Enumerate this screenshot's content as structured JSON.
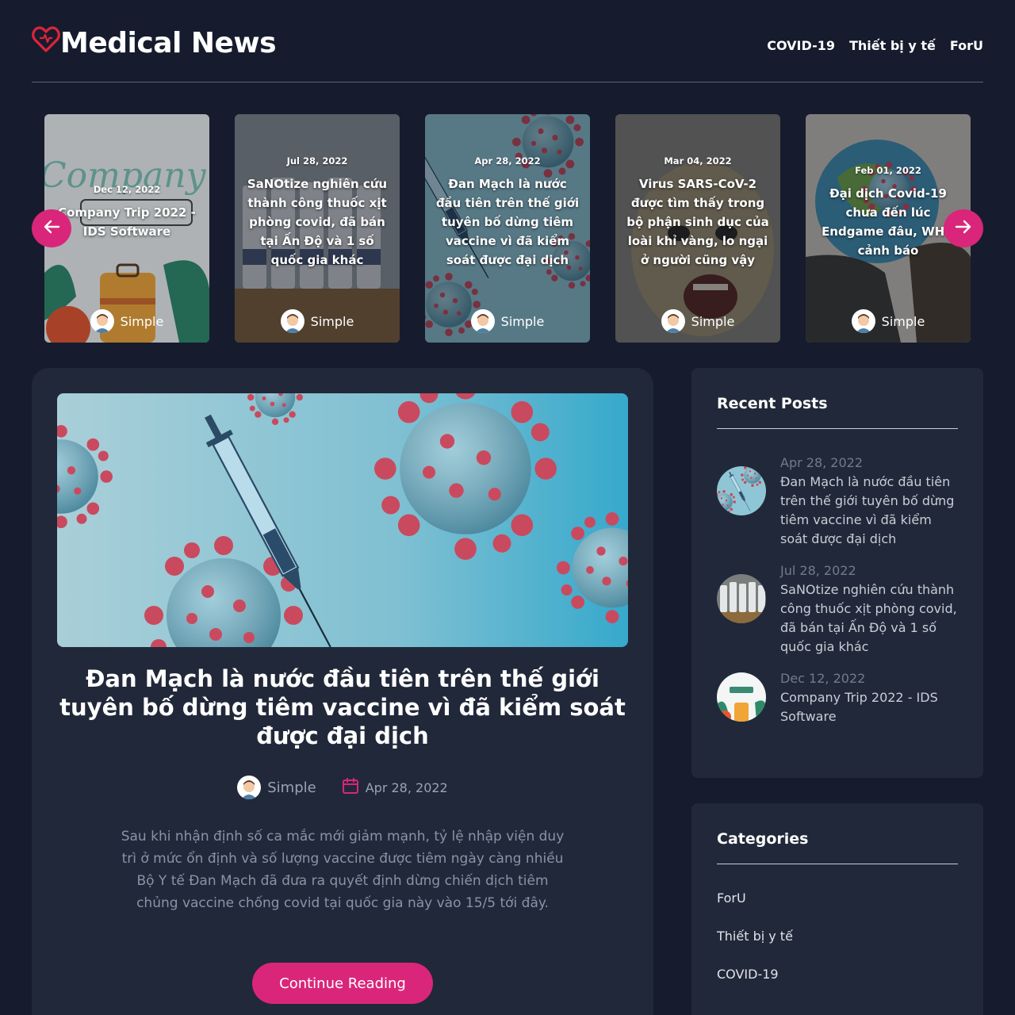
{
  "brand": {
    "name": "Medical News",
    "logo_icon": "heart-icon",
    "accent": "#d9267a"
  },
  "nav": [
    {
      "label": "COVID-19"
    },
    {
      "label": "Thiết bị y tế"
    },
    {
      "label": "ForU"
    }
  ],
  "carousel": {
    "prev_icon": "arrow-left-icon",
    "next_icon": "arrow-right-icon",
    "cards": [
      {
        "date": "Dec 12, 2022",
        "title": "Company Trip 2022 - IDS Software",
        "author": "Simple",
        "image": "company-trip-illustration"
      },
      {
        "date": "Jul 28, 2022",
        "title": "SaNOtize nghiên cứu thành công thuốc xịt phòng covid, đã bán tại Ấn Độ và 1 số quốc gia khác",
        "author": "Simple",
        "image": "spray-bottles-photo"
      },
      {
        "date": "Apr 28, 2022",
        "title": "Đan Mạch là nước đầu tiên trên thế giới tuyên bố dừng tiêm vaccine vì đã kiểm soát được đại dịch",
        "author": "Simple",
        "image": "virus-syringe-photo"
      },
      {
        "date": "Mar 04, 2022",
        "title": "Virus SARS-CoV-2 được tìm thấy trong bộ phận sinh dục của loài khỉ vàng, lo ngại ở người cũng vậy",
        "author": "Simple",
        "image": "monkey-photo"
      },
      {
        "date": "Feb 01, 2022",
        "title": "Đại dịch Covid-19 chưa đến lúc Endgame đâu, WHO cảnh báo",
        "author": "Simple",
        "image": "covid-globe-art"
      }
    ]
  },
  "main_post": {
    "title": "Đan Mạch là nước đầu tiên trên thế giới tuyên bố dừng tiêm vaccine vì đã kiểm soát được đại dịch",
    "author": "Simple",
    "date": "Apr 28, 2022",
    "date_icon": "calendar-icon",
    "excerpt": "Sau khi nhận định số ca mắc mới giảm mạnh, tỷ lệ nhập viện duy trì ở mức ổn định và số lượng vaccine được tiêm ngày càng nhiều Bộ Y tế Đan Mạch đã đưa ra quyết định dừng chiến dịch tiêm chủng vaccine chống covid tại quốc gia này vào 15/5 tới đây.",
    "button": "Continue Reading",
    "image": "virus-syringe-photo"
  },
  "recent_posts": {
    "heading": "Recent Posts",
    "items": [
      {
        "date": "Apr 28, 2022",
        "title": "Đan Mạch là nước đầu tiên trên thế giới tuyên bố dừng tiêm vaccine vì đã kiểm soát được đại dịch"
      },
      {
        "date": "Jul 28, 2022",
        "title": "SaNOtize nghiên cứu thành công thuốc xịt phòng covid, đã bán tại Ấn Độ và 1 số quốc gia khác"
      },
      {
        "date": "Dec 12, 2022",
        "title": "Company Trip 2022 - IDS Software"
      }
    ]
  },
  "categories": {
    "heading": "Categories",
    "items": [
      {
        "label": "ForU"
      },
      {
        "label": "Thiết bị y tế"
      },
      {
        "label": "COVID-19"
      }
    ]
  }
}
